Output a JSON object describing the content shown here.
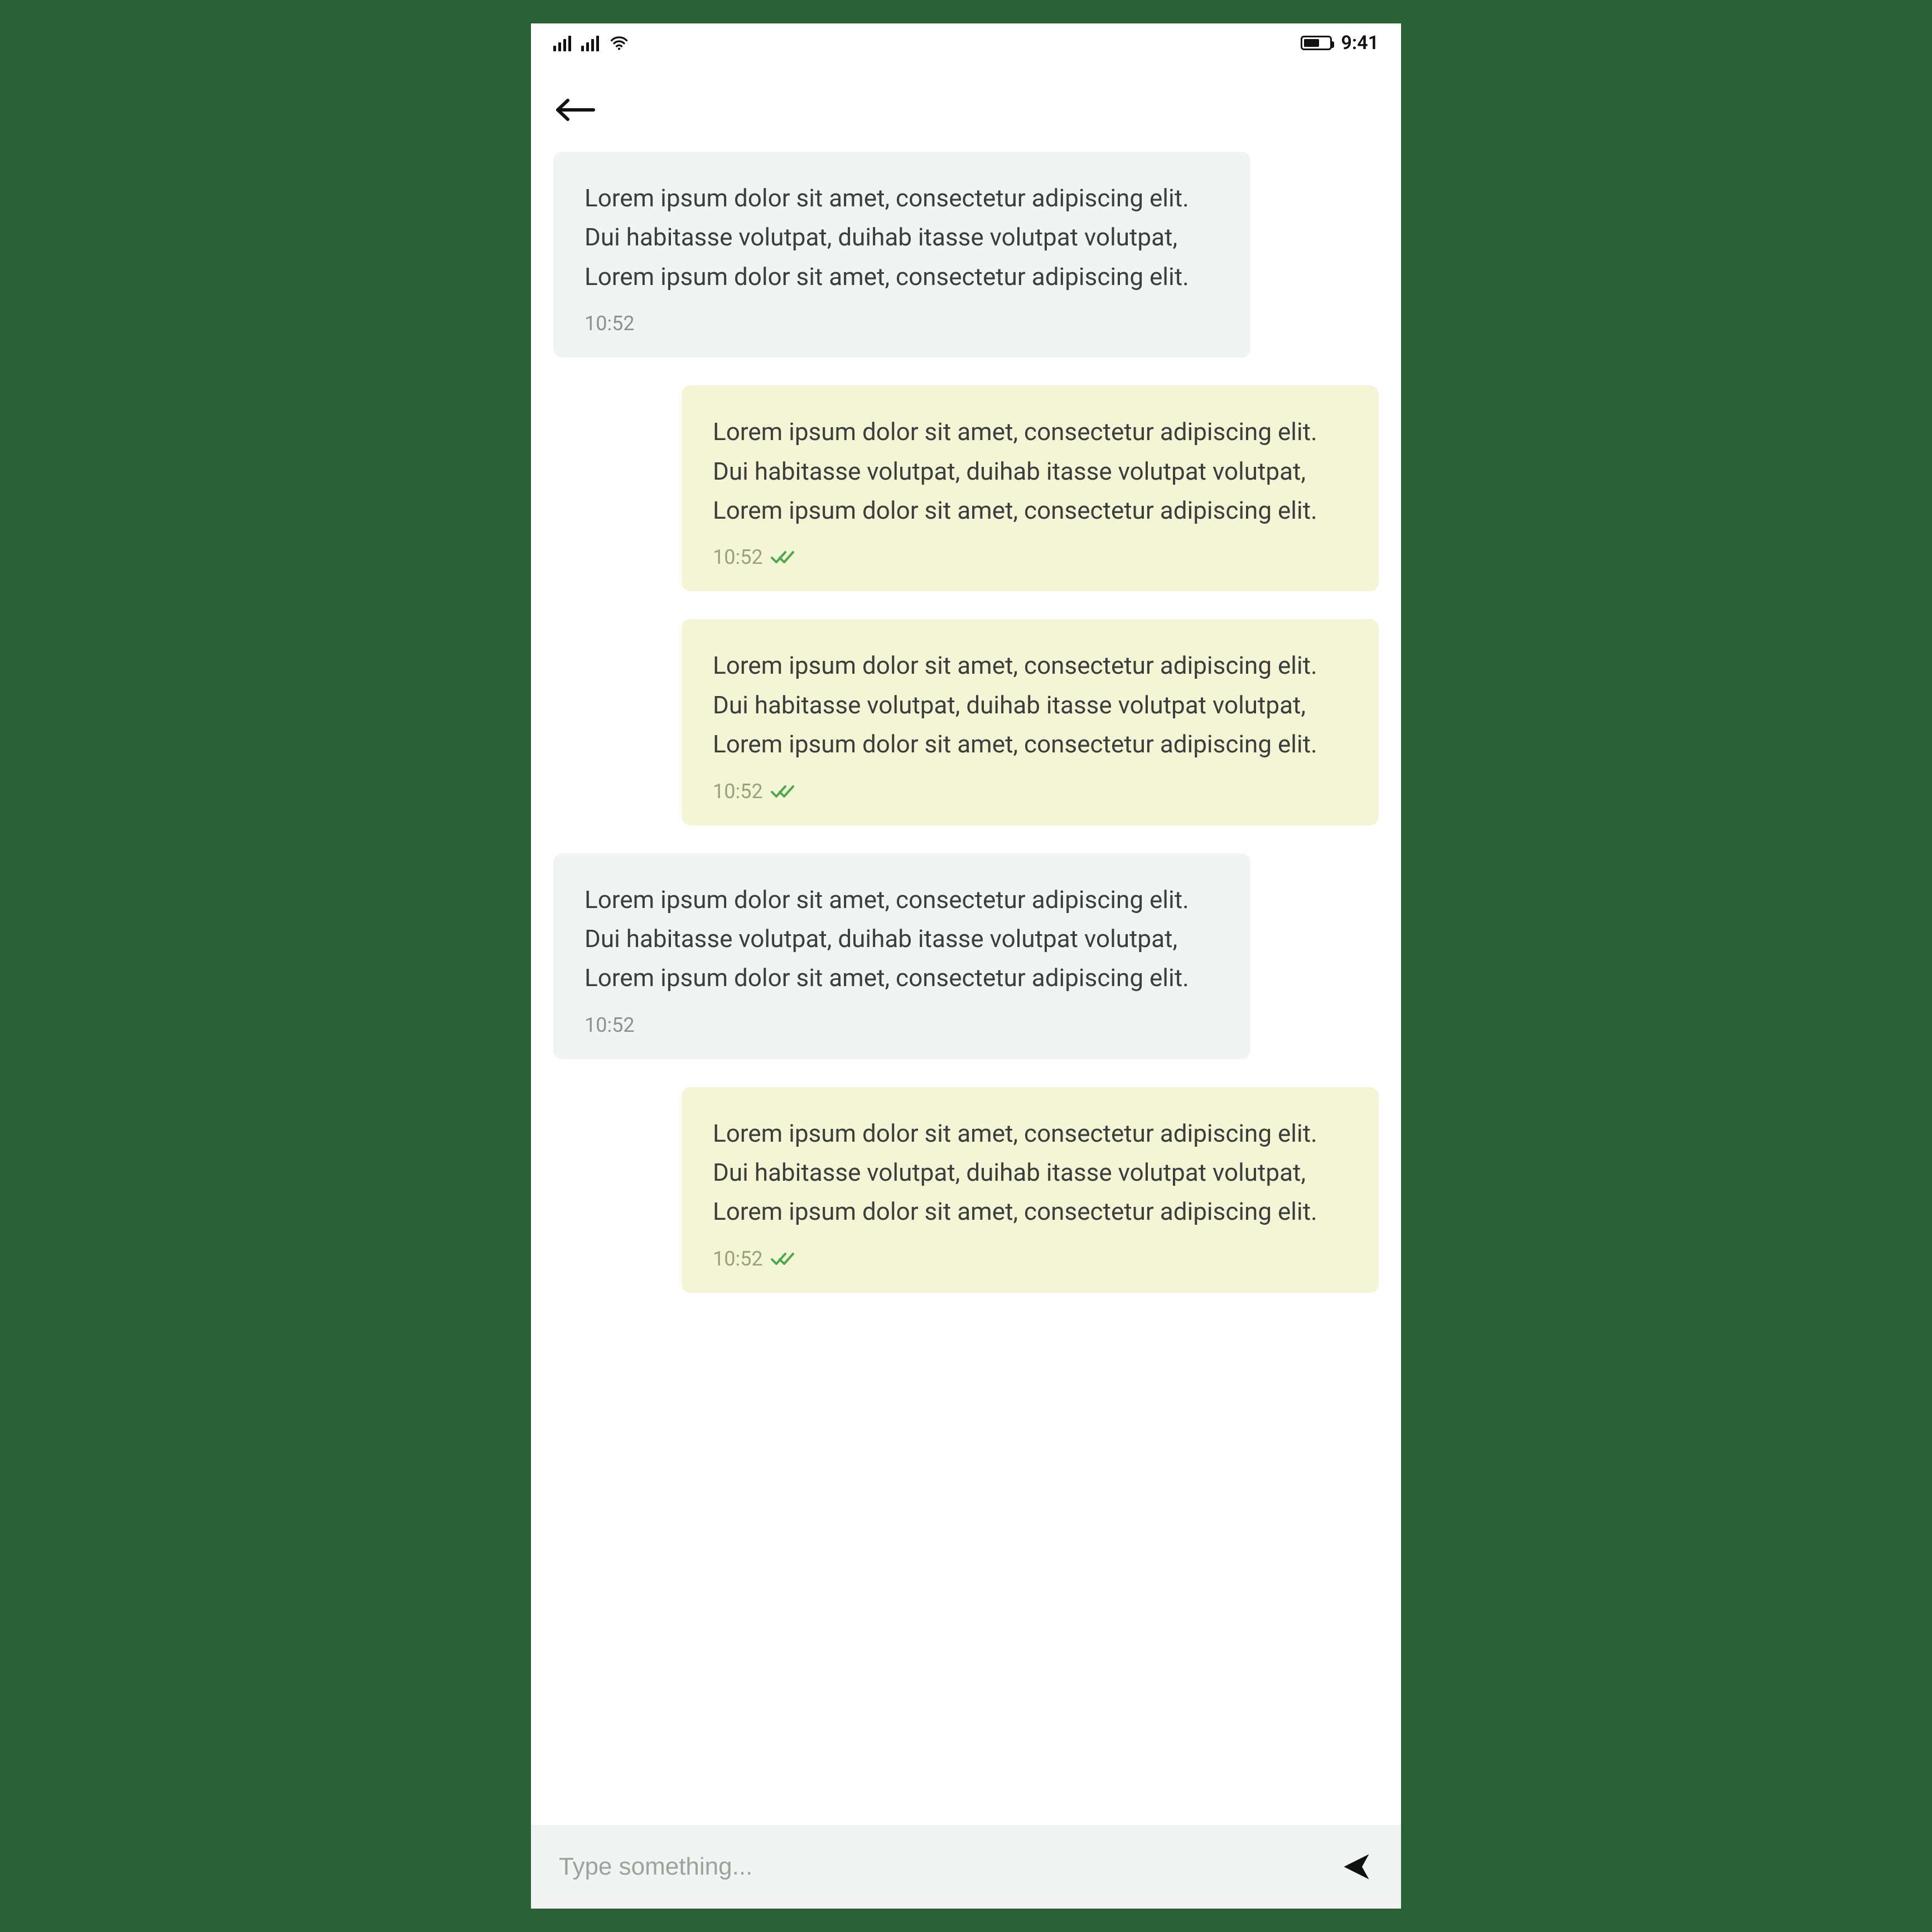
{
  "status": {
    "time": "9:41"
  },
  "messages": [
    {
      "side": "in",
      "text": "Lorem ipsum dolor sit amet, consectetur adipiscing elit. Dui habitasse volutpat, duihab itasse volutpat volutpat, Lorem ipsum dolor sit amet, consectetur adipiscing elit.",
      "time": "10:52",
      "read": false
    },
    {
      "side": "out",
      "text": "Lorem ipsum dolor sit amet, consectetur adipiscing elit. Dui habitasse volutpat, duihab itasse volutpat volutpat, Lorem ipsum dolor sit amet, consectetur adipiscing elit.",
      "time": "10:52",
      "read": true
    },
    {
      "side": "out",
      "text": "Lorem ipsum dolor sit amet, consectetur adipiscing elit. Dui habitasse volutpat, duihab itasse volutpat volutpat, Lorem ipsum dolor sit amet, consectetur adipiscing elit.",
      "time": "10:52",
      "read": true
    },
    {
      "side": "in",
      "text": "Lorem ipsum dolor sit amet, consectetur adipiscing elit. Dui habitasse volutpat, duihab itasse volutpat volutpat, Lorem ipsum dolor sit amet, consectetur adipiscing elit.",
      "time": "10:52",
      "read": false
    },
    {
      "side": "out",
      "text": "Lorem ipsum dolor sit amet, consectetur adipiscing elit. Dui habitasse volutpat, duihab itasse volutpat volutpat, Lorem ipsum dolor sit amet, consectetur adipiscing elit.",
      "time": "10:52",
      "read": true
    }
  ],
  "input": {
    "placeholder": "Type something...",
    "value": ""
  },
  "colors": {
    "checkmark": "#4aa94a"
  }
}
